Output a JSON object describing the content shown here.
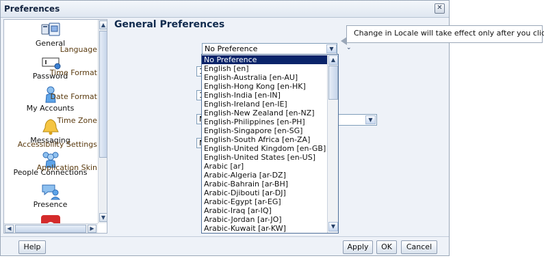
{
  "dialog": {
    "title": "Preferences",
    "close_label": "✕"
  },
  "sidebar": {
    "items": [
      {
        "label": "General",
        "icon": "general-settings-icon"
      },
      {
        "label": "Password",
        "icon": "password-icon"
      },
      {
        "label": "My Accounts",
        "icon": "person-icon"
      },
      {
        "label": "Messaging",
        "icon": "bell-icon"
      },
      {
        "label": "People Connections",
        "icon": "people-icon"
      },
      {
        "label": "Presence",
        "icon": "presence-icon"
      }
    ]
  },
  "main": {
    "title": "General Preferences",
    "labels": {
      "language": "Language",
      "time_format": "Time Format",
      "date_format": "Date Format",
      "time_zone": "Time Zone",
      "accessibility": "Accessibility Settings",
      "skin": "Application Skin"
    },
    "language_value": "No Preference",
    "time_format_value": "1",
    "date_format_value": "1",
    "time_zone_value": "M",
    "accessibility_value": "N"
  },
  "language_options": [
    "No Preference",
    "English [en]",
    "English-Australia [en-AU]",
    "English-Hong Kong [en-HK]",
    "English-India [en-IN]",
    "English-Ireland [en-IE]",
    "English-New Zealand [en-NZ]",
    "English-Philippines [en-PH]",
    "English-Singapore [en-SG]",
    "English-South Africa [en-ZA]",
    "English-United Kingdom [en-GB]",
    "English-United States [en-US]",
    "Arabic [ar]",
    "Arabic-Algeria [ar-DZ]",
    "Arabic-Bahrain [ar-BH]",
    "Arabic-Djibouti [ar-DJ]",
    "Arabic-Egypt [ar-EG]",
    "Arabic-Iraq [ar-IQ]",
    "Arabic-Jordan [ar-JO]",
    "Arabic-Kuwait [ar-KW]"
  ],
  "tooltip": "Change in Locale will take effect only after you click OK",
  "footer": {
    "help": "Help",
    "apply": "Apply",
    "ok": "OK",
    "cancel": "Cancel"
  },
  "colors": {
    "selection": "#0a246a",
    "title": "#0f2a4d",
    "label": "#5a3a0e"
  }
}
